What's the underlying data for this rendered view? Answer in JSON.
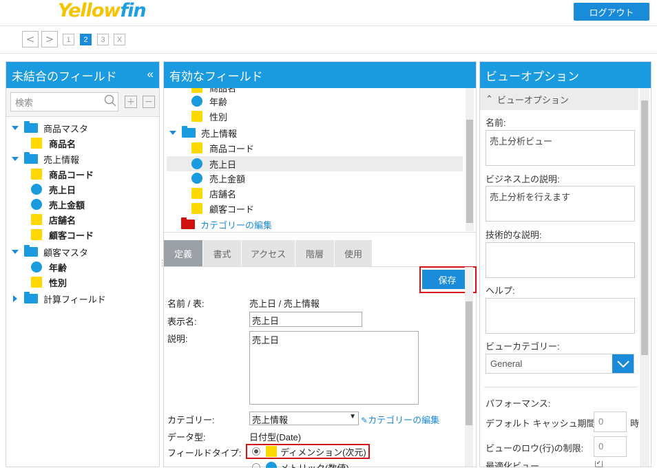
{
  "header": {
    "logo": "Yellowfin",
    "logout_label": "ログアウト"
  },
  "steps": {
    "prev": "<",
    "next": ">",
    "items": [
      "1",
      "2",
      "3",
      "X"
    ],
    "active": "2"
  },
  "left_panel": {
    "title": "未結合のフィールド",
    "collapse": "«",
    "search_placeholder": "検索",
    "tree": [
      {
        "label": "商品マスタ",
        "type": "folder"
      },
      {
        "label": "商品名",
        "type": "dimension"
      },
      {
        "label": "売上情報",
        "type": "folder"
      },
      {
        "label": "商品コード",
        "type": "dimension"
      },
      {
        "label": "売上日",
        "type": "metric"
      },
      {
        "label": "売上金額",
        "type": "metric"
      },
      {
        "label": "店舗名",
        "type": "dimension"
      },
      {
        "label": "顧客コード",
        "type": "dimension"
      },
      {
        "label": "顧客マスタ",
        "type": "folder"
      },
      {
        "label": "年齢",
        "type": "metric"
      },
      {
        "label": "性別",
        "type": "dimension"
      },
      {
        "label": "計算フィールド",
        "type": "folder-collapsed"
      }
    ]
  },
  "middle_panel": {
    "title": "有効なフィールド",
    "tree": [
      {
        "label": "商品名",
        "type": "dimension"
      },
      {
        "label": "年齢",
        "type": "metric"
      },
      {
        "label": "性別",
        "type": "dimension"
      },
      {
        "label": "売上情報",
        "type": "folder"
      },
      {
        "label": "商品コード",
        "type": "dimension"
      },
      {
        "label": "売上日",
        "type": "metric"
      },
      {
        "label": "売上金額",
        "type": "metric"
      },
      {
        "label": "店舗名",
        "type": "dimension"
      },
      {
        "label": "顧客コード",
        "type": "dimension"
      },
      {
        "label": "カテゴリーの編集",
        "type": "edit-folder"
      }
    ],
    "tabs": [
      "定義",
      "書式",
      "アクセス",
      "階層",
      "使用"
    ],
    "active_tab": "定義",
    "save_label": "保存",
    "form": {
      "name_table_label": "名前 / 表:",
      "name_table_value": "売上日 / 売上情報",
      "display_name_label": "表示名:",
      "display_name_value": "売上日",
      "description_label": "説明:",
      "description_value": "売上日",
      "category_label": "カテゴリー:",
      "category_value": "売上情報",
      "category_edit": "カテゴリーの編集",
      "datatype_label": "データ型:",
      "datatype_value": "日付型(Date)",
      "fieldtype_label": "フィールドタイプ:",
      "fieldtype_dimension": "ディメンション(次元)",
      "fieldtype_metric": "メトリック(数値)"
    }
  },
  "right_panel": {
    "title": "ビューオプション",
    "section_label": "ビューオプション",
    "name_label": "名前:",
    "name_value": "売上分析ビュー",
    "business_desc_label": "ビジネス上の説明:",
    "business_desc_value": "売上分析を行えます",
    "tech_desc_label": "技術的な説明:",
    "help_label": "ヘルプ:",
    "view_category_label": "ビューカテゴリー:",
    "view_category_value": "General",
    "performance_label": "パフォーマンス:",
    "cache_label": "デフォルト キャッシュ期間:",
    "cache_value": "0",
    "cache_unit": "時",
    "row_limit_label": "ビューのロウ(行)の制限:",
    "row_limit_value": "0",
    "optimize_label": "最適化ビュー"
  },
  "colors": {
    "accent": "#1a9be0",
    "dimension": "#ffd800",
    "metric": "#1a9be0",
    "highlight": "#d8101c"
  }
}
